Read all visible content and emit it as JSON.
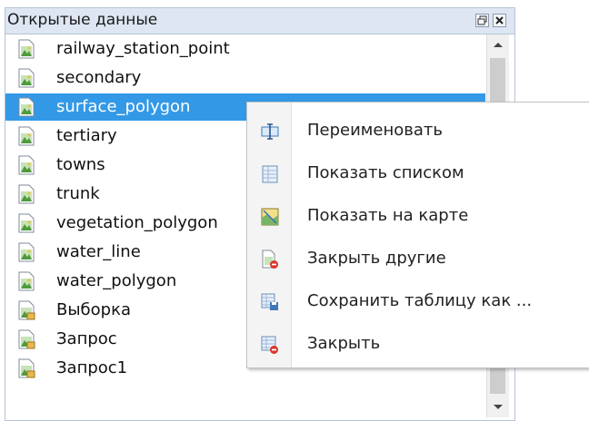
{
  "panel": {
    "title": "Открытые данные",
    "restore_icon": "restore-window-icon",
    "close_icon": "close-icon"
  },
  "items": [
    {
      "label": "railway_station_point",
      "icon": "map-layer-icon",
      "selected": false
    },
    {
      "label": "secondary",
      "icon": "map-layer-icon",
      "selected": false
    },
    {
      "label": "surface_polygon",
      "icon": "map-layer-icon",
      "selected": true
    },
    {
      "label": "tertiary",
      "icon": "map-layer-icon",
      "selected": false
    },
    {
      "label": "towns",
      "icon": "map-layer-icon",
      "selected": false
    },
    {
      "label": "trunk",
      "icon": "map-layer-icon",
      "selected": false
    },
    {
      "label": "vegetation_polygon",
      "icon": "map-layer-icon",
      "selected": false
    },
    {
      "label": "water_line",
      "icon": "map-layer-icon",
      "selected": false
    },
    {
      "label": "water_polygon",
      "icon": "map-layer-icon",
      "selected": false
    },
    {
      "label": "Выборка",
      "icon": "query-layer-icon",
      "selected": false
    },
    {
      "label": "Запрос",
      "icon": "query-layer-icon",
      "selected": false
    },
    {
      "label": "Запрос1",
      "icon": "query-layer-icon",
      "selected": false
    }
  ],
  "context_menu": {
    "items": [
      {
        "label": "Переименовать",
        "icon": "rename-icon"
      },
      {
        "label": "Показать списком",
        "icon": "table-list-icon"
      },
      {
        "label": "Показать на карте",
        "icon": "map-icon"
      },
      {
        "label": "Закрыть другие",
        "icon": "close-others-icon"
      },
      {
        "label": "Сохранить таблицу как ...",
        "icon": "save-table-icon"
      },
      {
        "label": "Закрыть",
        "icon": "close-table-icon"
      }
    ]
  },
  "colors": {
    "selection": "#3399e6",
    "title_bar": "#dde6f2"
  }
}
